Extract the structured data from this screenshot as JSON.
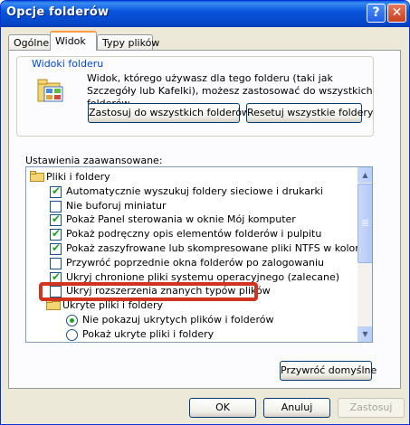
{
  "window": {
    "title": "Opcje folderów"
  },
  "titlebar_buttons": {
    "help": "?",
    "close": "✕"
  },
  "tabs": [
    "Ogólne",
    "Widok",
    "Typy plików"
  ],
  "active_tab": "Widok",
  "folder_views": {
    "legend": "Widoki folderu",
    "description": "Widok, którego używasz dla tego folderu (taki jak Szczegóły lub Kafelki), możesz zastosować do wszystkich folderów.",
    "apply_all_label": "Zastosuj do wszystkich folderów",
    "reset_all_label": "Resetuj wszystkie foldery"
  },
  "advanced": {
    "label": "Ustawienia zaawansowane:",
    "items": [
      {
        "type": "folder",
        "label": "Pliki i foldery",
        "indent": 0
      },
      {
        "type": "checkbox",
        "label": "Automatycznie wyszukuj foldery sieciowe i drukarki",
        "checked": true,
        "indent": 1
      },
      {
        "type": "checkbox",
        "label": "Nie buforuj miniatur",
        "checked": false,
        "indent": 1
      },
      {
        "type": "checkbox",
        "label": "Pokaż Panel sterowania w oknie Mój komputer",
        "checked": true,
        "indent": 1
      },
      {
        "type": "checkbox",
        "label": "Pokaż podręczny opis elementów folderów i pulpitu",
        "checked": true,
        "indent": 1
      },
      {
        "type": "checkbox",
        "label": "Pokaż zaszyfrowane lub skompresowane pliki NTFS w kolorze",
        "checked": true,
        "indent": 1
      },
      {
        "type": "checkbox",
        "label": "Przywróć poprzednie okna folderów po zalogowaniu",
        "checked": false,
        "indent": 1
      },
      {
        "type": "checkbox",
        "label": "Ukryj chronione pliki systemu operacyjnego (zalecane)",
        "checked": true,
        "indent": 1
      },
      {
        "type": "checkbox",
        "label": "Ukryj rozszerzenia znanych typów plików",
        "checked": false,
        "indent": 1
      },
      {
        "type": "folder",
        "label": "Ukryte pliki i foldery",
        "indent": 1
      },
      {
        "type": "radio",
        "label": "Nie pokazuj ukrytych plików i folderów",
        "selected": true,
        "indent": 2
      },
      {
        "type": "radio",
        "label": "Pokaż ukryte pliki i foldery",
        "selected": false,
        "indent": 2
      }
    ]
  },
  "restore_defaults_label": "Przywróć domyślne",
  "footer": {
    "ok": "OK",
    "cancel": "Anuluj",
    "apply": "Zastosuj"
  },
  "colors": {
    "titlebar": "#0a5fd8",
    "check": "#21a121",
    "annotation": "#d23420",
    "legend": "#0046d5"
  }
}
